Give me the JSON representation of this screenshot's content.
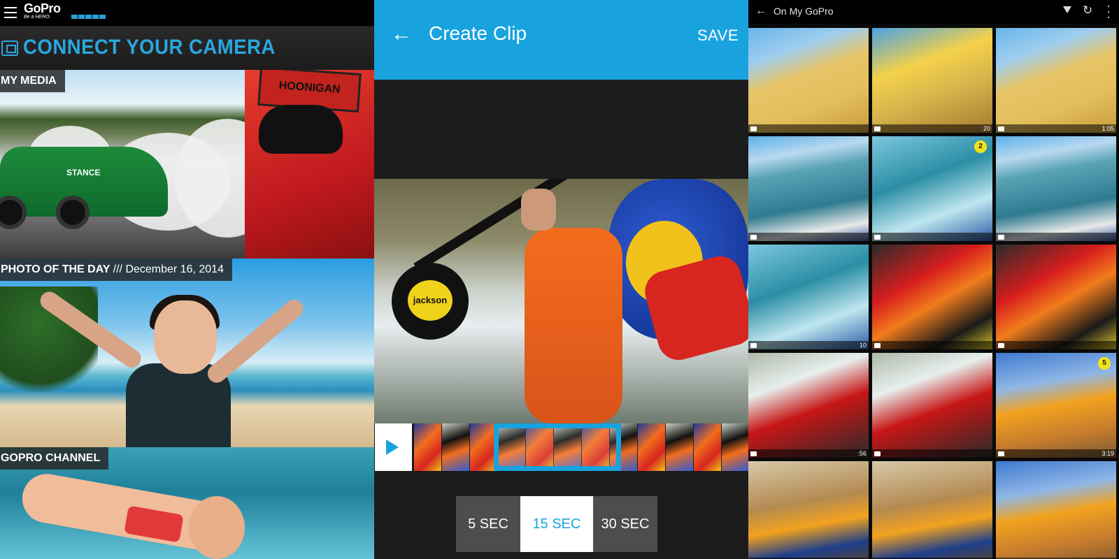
{
  "panel1": {
    "brand": {
      "wordmark": "GoPro",
      "tagline": "Be a HERO."
    },
    "connect_title": "CONNECT YOUR CAMERA",
    "sections": {
      "my_media": "MY MEDIA",
      "photo_of_day": "PHOTO OF THE DAY",
      "photo_of_day_separator": "///",
      "photo_of_day_date": "December 16, 2014",
      "channel": "GOPRO CHANNEL"
    },
    "image_text": {
      "hoonigan": "HOONIGAN",
      "car_sponsor": "STANCE"
    },
    "accent_color": "#2aa7e0"
  },
  "panel2": {
    "appbar": {
      "title": "Create Clip",
      "action": "SAVE",
      "back_icon": "arrow-left-icon"
    },
    "paddle_text": "jackson",
    "durations": [
      {
        "label": "5 SEC",
        "selected": false
      },
      {
        "label": "15 SEC",
        "selected": true
      },
      {
        "label": "30 SEC",
        "selected": false
      }
    ],
    "accent_color": "#18a3df"
  },
  "panel3": {
    "header": {
      "title": "On My GoPro",
      "back_icon": "arrow-left-icon",
      "filter_icon": "filter-icon",
      "refresh_icon": "refresh-icon",
      "more_icon": "more-vertical-icon"
    },
    "tiles": [
      {
        "kind": "buggy",
        "duration": ""
      },
      {
        "kind": "buggy2",
        "duration": "20"
      },
      {
        "kind": "buggy",
        "duration": "1:05"
      },
      {
        "kind": "surf",
        "duration": ""
      },
      {
        "kind": "surf2",
        "duration": "",
        "badge": "2"
      },
      {
        "kind": "surf",
        "duration": ""
      },
      {
        "kind": "surf2",
        "duration": "10"
      },
      {
        "kind": "kayak",
        "duration": ""
      },
      {
        "kind": "kayak",
        "duration": ""
      },
      {
        "kind": "kayak2",
        "duration": ":56"
      },
      {
        "kind": "kayak2",
        "duration": ""
      },
      {
        "kind": "moto",
        "duration": "3:19",
        "badge": "5"
      },
      {
        "kind": "moto2",
        "duration": ""
      },
      {
        "kind": "moto2",
        "duration": ""
      },
      {
        "kind": "moto",
        "duration": ""
      }
    ]
  }
}
